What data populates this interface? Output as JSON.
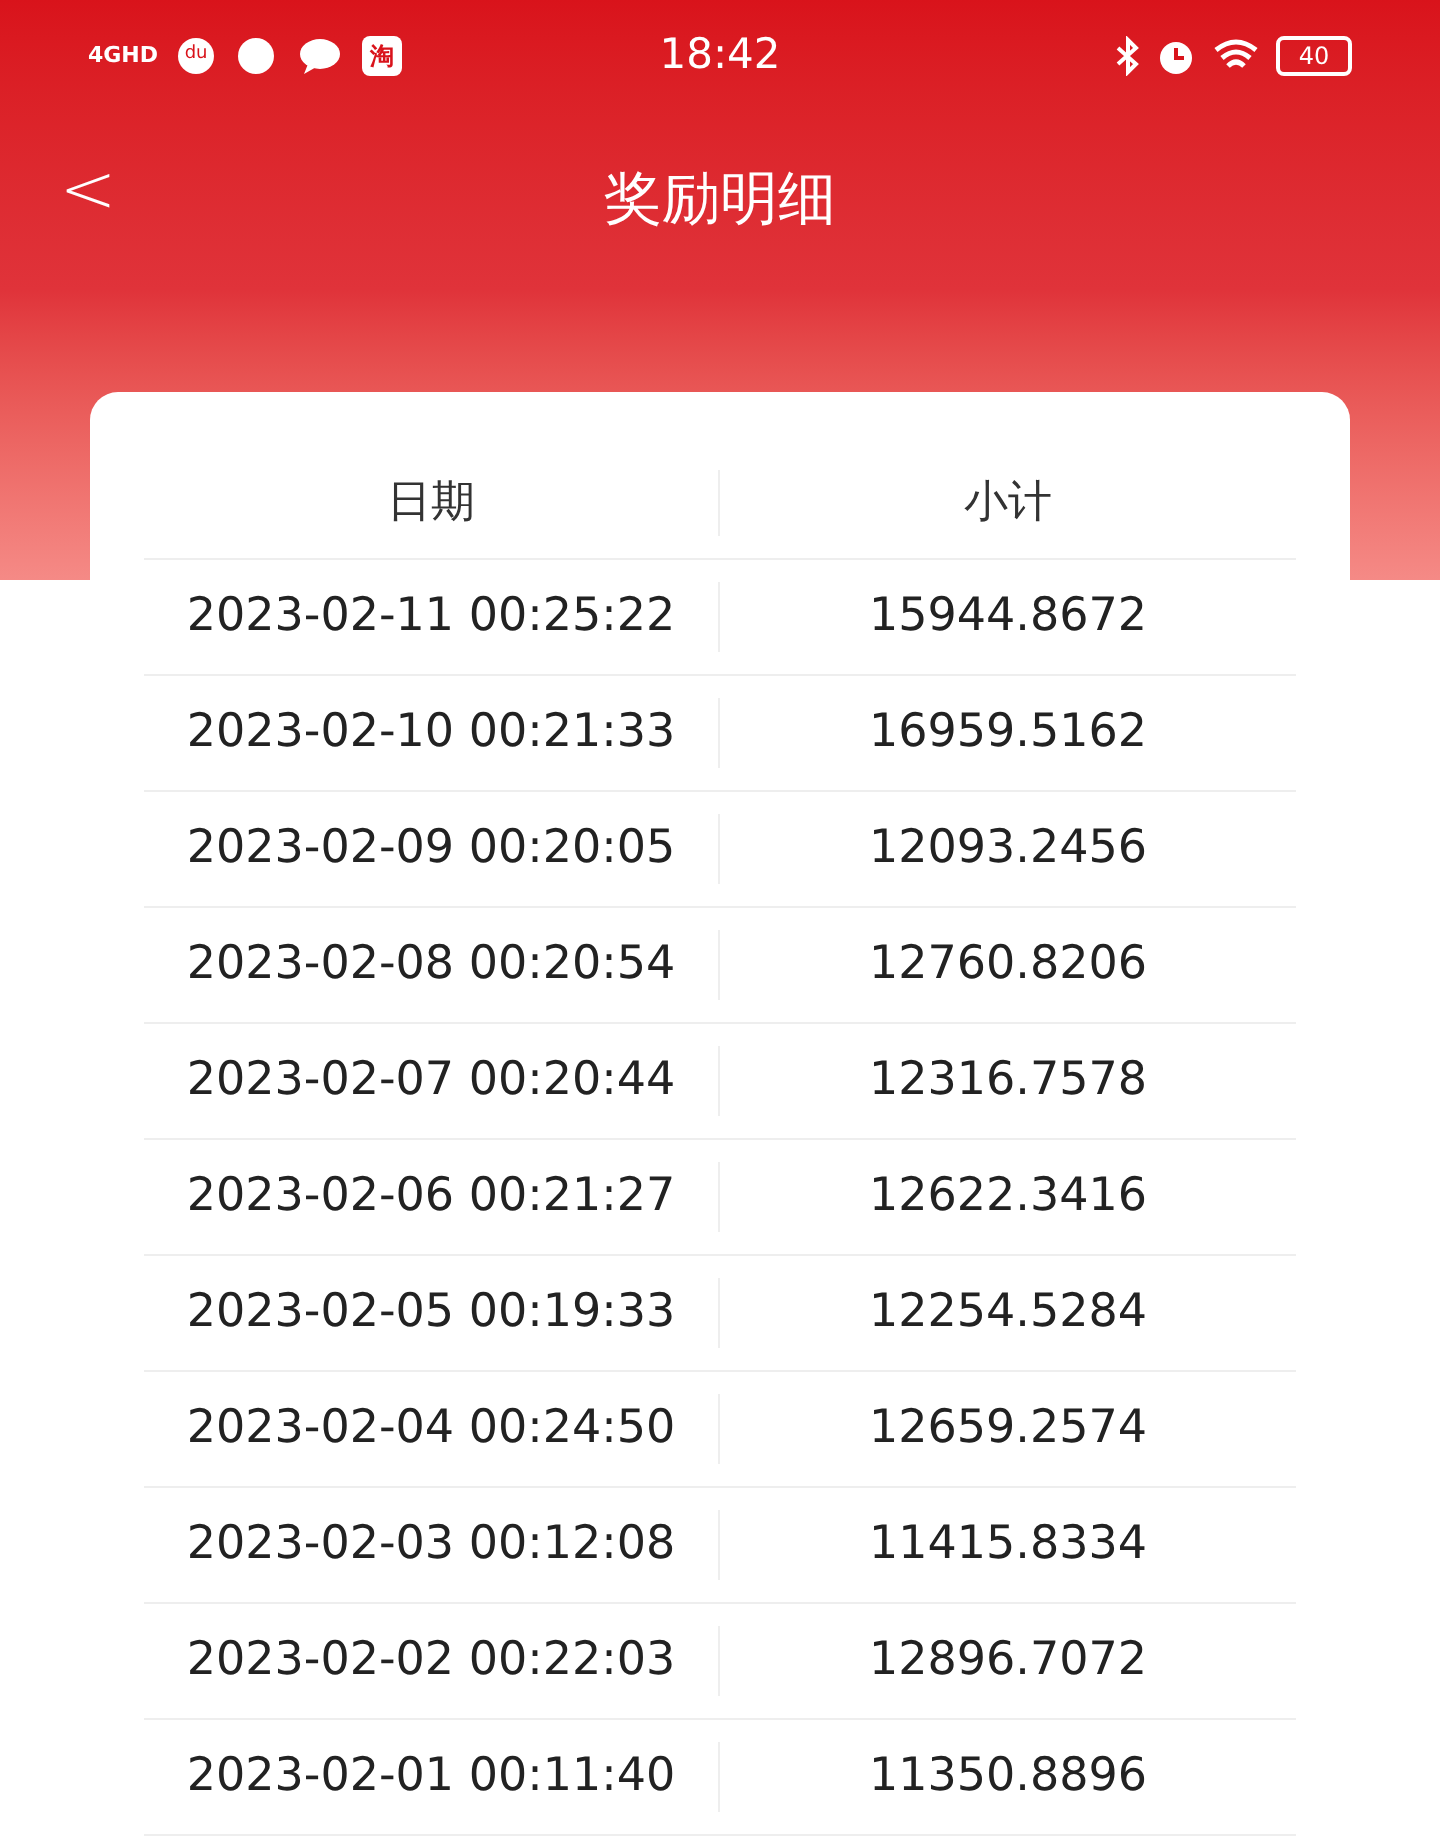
{
  "status_bar": {
    "network": "4GHD",
    "app_badge": "du",
    "shop_badge": "淘",
    "time": "18:42",
    "battery": "40"
  },
  "header": {
    "back": "<",
    "title": "奖励明细"
  },
  "table": {
    "columns": [
      "日期",
      "小计"
    ],
    "rows": [
      [
        "2023-02-11 00:25:22",
        "15944.8672"
      ],
      [
        "2023-02-10 00:21:33",
        "16959.5162"
      ],
      [
        "2023-02-09 00:20:05",
        "12093.2456"
      ],
      [
        "2023-02-08 00:20:54",
        "12760.8206"
      ],
      [
        "2023-02-07 00:20:44",
        "12316.7578"
      ],
      [
        "2023-02-06 00:21:27",
        "12622.3416"
      ],
      [
        "2023-02-05 00:19:33",
        "12254.5284"
      ],
      [
        "2023-02-04 00:24:50",
        "12659.2574"
      ],
      [
        "2023-02-03 00:12:08",
        "11415.8334"
      ],
      [
        "2023-02-02 00:22:03",
        "12896.7072"
      ],
      [
        "2023-02-01 00:11:40",
        "11350.8896"
      ]
    ]
  }
}
